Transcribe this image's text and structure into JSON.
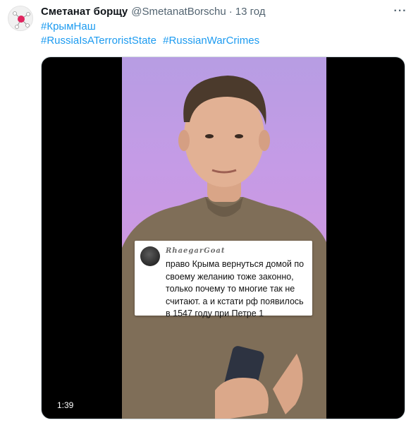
{
  "tweet": {
    "display_name": "Сметанат борщу",
    "handle": "@SmetanatBorschu",
    "separator": "·",
    "time": "13 год",
    "more_icon": "more-horizontal-icon",
    "hashtags_line1": [
      "#КрымНаш"
    ],
    "hashtags_line2": [
      "#RussiaIsATerroristState",
      "#RussianWarCrimes"
    ]
  },
  "media": {
    "duration": "1:39",
    "comment": {
      "username": "RhaegarGoat",
      "text": "право Крыма вернуться домой по своему желанию тоже законно, только почему то многие так не считают. а и кстати рф появилось в 1547 году при Петре 1"
    }
  },
  "colors": {
    "link": "#1d9bf0",
    "secondary_text": "#536471",
    "media_background": "#000000"
  }
}
